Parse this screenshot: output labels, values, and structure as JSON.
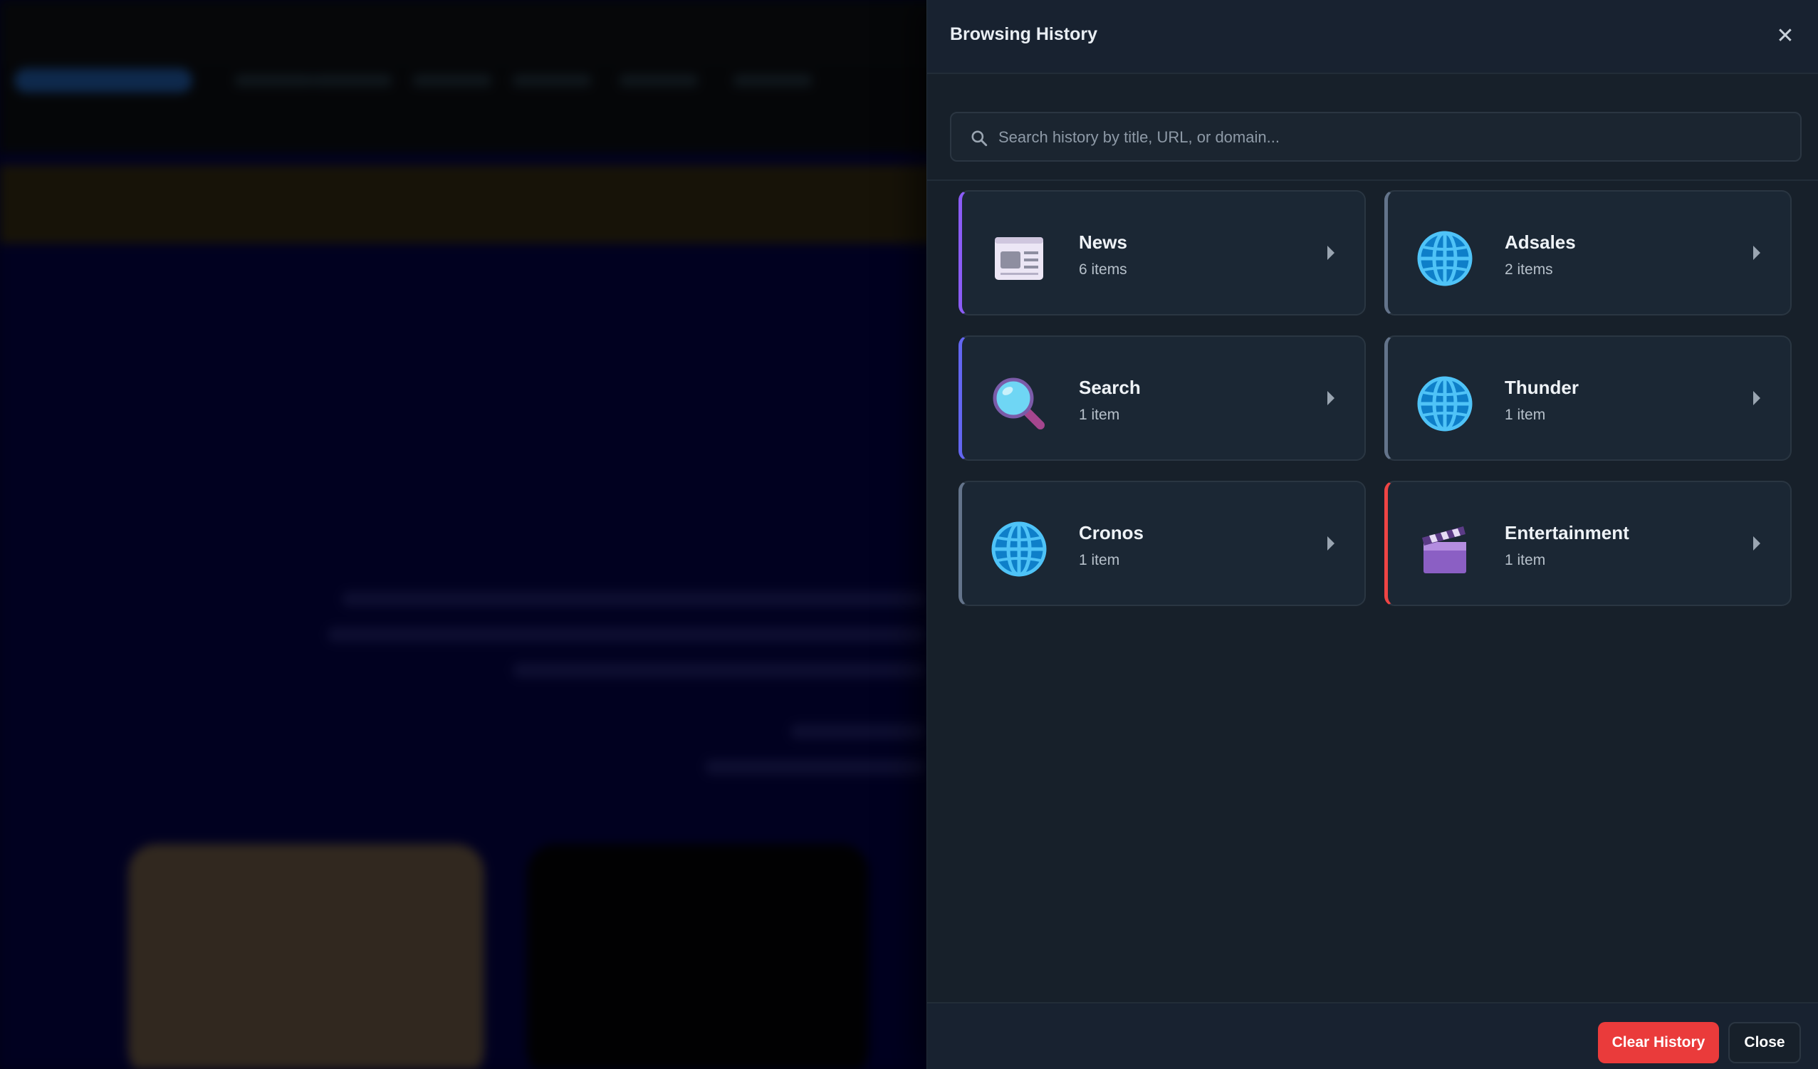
{
  "drawer": {
    "title": "Browsing History",
    "close_icon": "close-icon",
    "search": {
      "placeholder": "Search history by title, URL, or domain...",
      "value": "",
      "icon": "search-icon"
    },
    "categories": [
      {
        "name": "News",
        "count": "6 items",
        "icon": "newspaper-icon",
        "accent": "#8b5cf6"
      },
      {
        "name": "Adsales",
        "count": "2 items",
        "icon": "globe-icon",
        "accent": "#64748b"
      },
      {
        "name": "Search",
        "count": "1 item",
        "icon": "magnifier-icon",
        "accent": "#6366f1"
      },
      {
        "name": "Thunder",
        "count": "1 item",
        "icon": "globe-icon",
        "accent": "#64748b"
      },
      {
        "name": "Cronos",
        "count": "1 item",
        "icon": "globe-icon",
        "accent": "#64748b"
      },
      {
        "name": "Entertainment",
        "count": "1 item",
        "icon": "clapperboard-icon",
        "accent": "#ef4444"
      }
    ],
    "footer": {
      "clear_label": "Clear History",
      "close_label": "Close"
    }
  },
  "colors": {
    "drawer_bg": "#17202a",
    "card_bg": "#1b2734",
    "danger": "#ea3b3b"
  }
}
